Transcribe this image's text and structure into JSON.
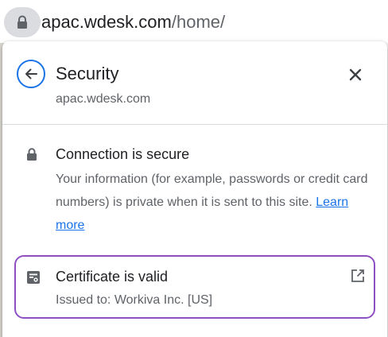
{
  "omnibox": {
    "url_host": "apac.wdesk.com",
    "url_path": "/home/",
    "lock_icon": "lock-icon"
  },
  "popup": {
    "title": "Security",
    "site": "apac.wdesk.com",
    "back_icon": "back-arrow-icon",
    "close_icon": "close-icon",
    "connection": {
      "icon": "lock-icon",
      "title": "Connection is secure",
      "description": "Your information (for example, passwords or credit card numbers) is private when it is sent to this site.",
      "learn_more": "Learn more"
    },
    "certificate": {
      "icon": "certificate-icon",
      "title": "Certificate is valid",
      "issued_to": "Issued to: Workiva Inc. [US]",
      "open_icon": "external-link-icon"
    }
  },
  "colors": {
    "accent_blue": "#1a73e8",
    "highlight_purple": "#8e4fc3",
    "text_primary": "#202124",
    "text_secondary": "#5f6368"
  }
}
